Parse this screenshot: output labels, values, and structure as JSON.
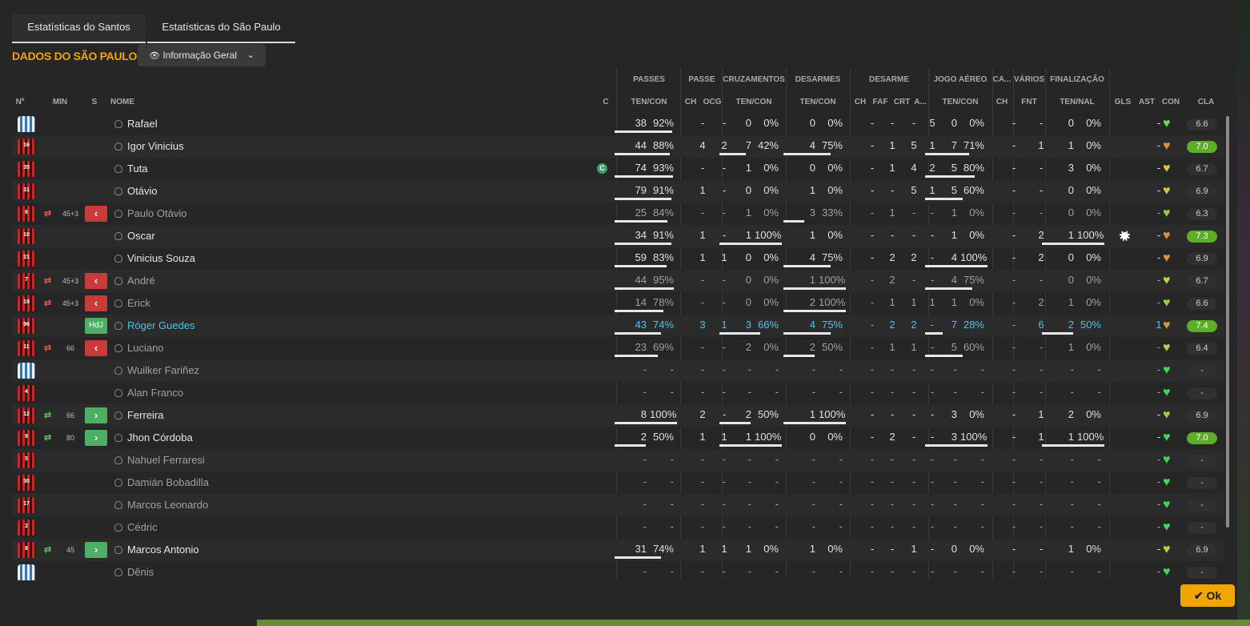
{
  "tabs": [
    "Estatísticas do Santos",
    "Estatísticas do São Paulo"
  ],
  "section_title": "DADOS DO SÃO PAULO",
  "dropdown": {
    "label": "Informação Geral",
    "icon": "eye-icon"
  },
  "group_headers": [
    "PASSES",
    "PASSE",
    "CRUZAMENTOS",
    "DESARMES",
    "DESARME",
    "JOGO AÉREO",
    "CA...",
    "VÁRIOS",
    "FINALIZAÇÃO"
  ],
  "column_headers": [
    "Nº",
    "MIN",
    "S",
    "NOME",
    "C",
    "TEN/CON",
    "CH",
    "OCG",
    "TEN/CON",
    "TEN/CON",
    "CH",
    "FAF",
    "CRT",
    "A...",
    "TEN/CON",
    "CH",
    "FNT",
    "TEN/NAL",
    "GLS",
    "AST",
    "CON",
    "CLA"
  ],
  "captain_badge": "C",
  "ok_button": "Ok",
  "players": [
    {
      "num": "",
      "kit": "gk",
      "min": "",
      "sub": "",
      "name": "Rafael",
      "style": "",
      "cap": false,
      "p": [
        "38",
        "92%"
      ],
      "pf": 0.92,
      "ch": "-",
      "ocg": "-",
      "cr": [
        "0",
        "0%"
      ],
      "crf": 0,
      "ds": [
        "0",
        "0%"
      ],
      "dsf": 0,
      "dch": "-",
      "faf": "-",
      "crt": "-",
      "a": "5",
      "ja": [
        "0",
        "0%"
      ],
      "jaf": 0,
      "ca": "-",
      "fnt": "-",
      "fn": [
        "0",
        "0%"
      ],
      "fnf": 0,
      "gls": "",
      "ast": "-",
      "heart": "#66dd55",
      "cla": "6.6",
      "good": false
    },
    {
      "num": "16",
      "kit": "sp",
      "min": "",
      "sub": "",
      "name": "Igor Vinicius",
      "style": "",
      "cap": false,
      "p": [
        "44",
        "88%"
      ],
      "pf": 0.88,
      "ch": "4",
      "ocg": "2",
      "cr": [
        "7",
        "42%"
      ],
      "crf": 0.42,
      "ds": [
        "4",
        "75%"
      ],
      "dsf": 0.75,
      "dch": "-",
      "faf": "1",
      "crt": "5",
      "a": "1",
      "ja": [
        "7",
        "71%"
      ],
      "jaf": 0.71,
      "ca": "-",
      "fnt": "1",
      "fn": [
        "1",
        "0%"
      ],
      "fnf": 0,
      "gls": "",
      "ast": "-",
      "heart": "#d9953a",
      "cla": "7.0",
      "good": true
    },
    {
      "num": "35",
      "kit": "sp",
      "min": "",
      "sub": "",
      "name": "Tuta",
      "style": "",
      "cap": true,
      "p": [
        "74",
        "93%"
      ],
      "pf": 0.93,
      "ch": "-",
      "ocg": "-",
      "cr": [
        "1",
        "0%"
      ],
      "crf": 0,
      "ds": [
        "0",
        "0%"
      ],
      "dsf": 0,
      "dch": "-",
      "faf": "1",
      "crt": "4",
      "a": "2",
      "ja": [
        "5",
        "80%"
      ],
      "jaf": 0.8,
      "ca": "-",
      "fnt": "-",
      "fn": [
        "3",
        "0%"
      ],
      "fnf": 0,
      "gls": "",
      "ast": "-",
      "heart": "#d9c43a",
      "cla": "6.7",
      "good": false
    },
    {
      "num": "31",
      "kit": "sp",
      "min": "",
      "sub": "",
      "name": "Otávio",
      "style": "",
      "cap": false,
      "p": [
        "79",
        "91%"
      ],
      "pf": 0.91,
      "ch": "1",
      "ocg": "-",
      "cr": [
        "0",
        "0%"
      ],
      "crf": 0,
      "ds": [
        "1",
        "0%"
      ],
      "dsf": 0,
      "dch": "-",
      "faf": "-",
      "crt": "5",
      "a": "1",
      "ja": [
        "5",
        "60%"
      ],
      "jaf": 0.6,
      "ca": "-",
      "fnt": "-",
      "fn": [
        "0",
        "0%"
      ],
      "fnf": 0,
      "gls": "",
      "ast": "-",
      "heart": "#d9c43a",
      "cla": "6.9",
      "good": false
    },
    {
      "num": "6",
      "kit": "sp",
      "min": "45+3",
      "sub": "out",
      "name": "Paulo Otávio",
      "style": "dim",
      "cap": false,
      "p": [
        "25",
        "84%"
      ],
      "pf": 0.84,
      "ch": "-",
      "ocg": "-",
      "cr": [
        "1",
        "0%"
      ],
      "crf": 0,
      "ds": [
        "3",
        "33%"
      ],
      "dsf": 0.33,
      "dch": "-",
      "faf": "1",
      "crt": "-",
      "a": "-",
      "ja": [
        "1",
        "0%"
      ],
      "jaf": 0,
      "ca": "-",
      "fnt": "-",
      "fn": [
        "0",
        "0%"
      ],
      "fnf": 0,
      "gls": "",
      "ast": "-",
      "heart": "#8fd23a",
      "cla": "6.3",
      "good": false
    },
    {
      "num": "10",
      "kit": "sp",
      "min": "",
      "sub": "",
      "name": "Oscar",
      "style": "",
      "cap": false,
      "p": [
        "34",
        "91%"
      ],
      "pf": 0.91,
      "ch": "1",
      "ocg": "-",
      "cr": [
        "1",
        "100%"
      ],
      "crf": 1,
      "ds": [
        "1",
        "0%"
      ],
      "dsf": 0,
      "dch": "-",
      "faf": "-",
      "crt": "-",
      "a": "-",
      "ja": [
        "1",
        "0%"
      ],
      "jaf": 0,
      "ca": "-",
      "fnt": "2",
      "fn": [
        "1",
        "100%"
      ],
      "fnf": 1,
      "gls": "ball",
      "ast": "-",
      "heart": "#d9953a",
      "cla": "7.3",
      "good": true
    },
    {
      "num": "21",
      "kit": "sp",
      "min": "",
      "sub": "",
      "name": "Vinicius Souza",
      "style": "",
      "cap": false,
      "p": [
        "59",
        "83%"
      ],
      "pf": 0.83,
      "ch": "1",
      "ocg": "1",
      "cr": [
        "0",
        "0%"
      ],
      "crf": 0,
      "ds": [
        "4",
        "75%"
      ],
      "dsf": 0.75,
      "dch": "-",
      "faf": "2",
      "crt": "2",
      "a": "-",
      "ja": [
        "4",
        "100%"
      ],
      "jaf": 1,
      "ca": "-",
      "fnt": "2",
      "fn": [
        "0",
        "0%"
      ],
      "fnf": 0,
      "gls": "",
      "ast": "-",
      "heart": "#d9953a",
      "cla": "6.9",
      "good": false
    },
    {
      "num": "7",
      "kit": "sp",
      "min": "45+3",
      "sub": "out",
      "name": "André",
      "style": "dim",
      "cap": false,
      "p": [
        "44",
        "95%"
      ],
      "pf": 0.95,
      "ch": "-",
      "ocg": "-",
      "cr": [
        "0",
        "0%"
      ],
      "crf": 0,
      "ds": [
        "1",
        "100%"
      ],
      "dsf": 1,
      "dch": "-",
      "faf": "2",
      "crt": "-",
      "a": "-",
      "ja": [
        "4",
        "75%"
      ],
      "jaf": 0.75,
      "ca": "-",
      "fnt": "-",
      "fn": [
        "0",
        "0%"
      ],
      "fnf": 0,
      "gls": "",
      "ast": "-",
      "heart": "#b8d23a",
      "cla": "6.7",
      "good": false
    },
    {
      "num": "19",
      "kit": "sp",
      "min": "45+3",
      "sub": "out",
      "name": "Erick",
      "style": "dim",
      "cap": false,
      "p": [
        "14",
        "78%"
      ],
      "pf": 0.78,
      "ch": "-",
      "ocg": "-",
      "cr": [
        "0",
        "0%"
      ],
      "crf": 0,
      "ds": [
        "2",
        "100%"
      ],
      "dsf": 1,
      "dch": "-",
      "faf": "1",
      "crt": "1",
      "a": "1",
      "ja": [
        "1",
        "0%"
      ],
      "jaf": 0,
      "ca": "-",
      "fnt": "2",
      "fn": [
        "1",
        "0%"
      ],
      "fnf": 0,
      "gls": "",
      "ast": "-",
      "heart": "#8fd23a",
      "cla": "6.6",
      "good": false
    },
    {
      "num": "96",
      "kit": "sp",
      "min": "",
      "sub": "hdj",
      "name": "Róger Guedes",
      "style": "blue",
      "cap": false,
      "p": [
        "43",
        "74%"
      ],
      "pf": 0.74,
      "ch": "3",
      "ocg": "1",
      "cr": [
        "3",
        "66%"
      ],
      "crf": 0.66,
      "ds": [
        "4",
        "75%"
      ],
      "dsf": 0.75,
      "dch": "-",
      "faf": "2",
      "crt": "2",
      "a": "-",
      "ja": [
        "7",
        "28%"
      ],
      "jaf": 0.28,
      "ca": "-",
      "fnt": "6",
      "fn": [
        "2",
        "50%"
      ],
      "fnf": 0.5,
      "gls": "",
      "ast": "1",
      "heart": "#d9953a",
      "cla": "7.4",
      "good": true
    },
    {
      "num": "11",
      "kit": "sp",
      "min": "66",
      "sub": "out",
      "name": "Luciano",
      "style": "dim",
      "cap": false,
      "p": [
        "23",
        "69%"
      ],
      "pf": 0.69,
      "ch": "-",
      "ocg": "-",
      "cr": [
        "2",
        "0%"
      ],
      "crf": 0,
      "ds": [
        "2",
        "50%"
      ],
      "dsf": 0.5,
      "dch": "-",
      "faf": "1",
      "crt": "1",
      "a": "-",
      "ja": [
        "5",
        "60%"
      ],
      "jaf": 0.6,
      "ca": "-",
      "fnt": "-",
      "fn": [
        "1",
        "0%"
      ],
      "fnf": 0,
      "gls": "",
      "ast": "-",
      "heart": "#b8d23a",
      "cla": "6.4",
      "good": false
    },
    {
      "num": "",
      "kit": "gk",
      "min": "",
      "sub": "",
      "name": "Wuilker Fariñez",
      "style": "dim",
      "cap": false,
      "p": [
        "-",
        "-"
      ],
      "pf": 0,
      "ch": "-",
      "ocg": "-",
      "cr": [
        "-",
        "-"
      ],
      "crf": 0,
      "ds": [
        "-",
        "-"
      ],
      "dsf": 0,
      "dch": "-",
      "faf": "-",
      "crt": "-",
      "a": "-",
      "ja": [
        "-",
        "-"
      ],
      "jaf": 0,
      "ca": "-",
      "fnt": "-",
      "fn": [
        "-",
        "-"
      ],
      "fnf": 0,
      "gls": "",
      "ast": "-",
      "heart": "#3ad95a",
      "cla": "-",
      "good": false
    },
    {
      "num": "4",
      "kit": "sp",
      "min": "",
      "sub": "",
      "name": "Alan Franco",
      "style": "dim",
      "cap": false,
      "p": [
        "-",
        "-"
      ],
      "pf": 0,
      "ch": "-",
      "ocg": "-",
      "cr": [
        "-",
        "-"
      ],
      "crf": 0,
      "ds": [
        "-",
        "-"
      ],
      "dsf": 0,
      "dch": "-",
      "faf": "-",
      "crt": "-",
      "a": "-",
      "ja": [
        "-",
        "-"
      ],
      "jaf": 0,
      "ca": "-",
      "fnt": "-",
      "fn": [
        "-",
        "-"
      ],
      "fnf": 0,
      "gls": "",
      "ast": "-",
      "heart": "#3ad95a",
      "cla": "-",
      "good": false
    },
    {
      "num": "12",
      "kit": "sp",
      "min": "66",
      "sub": "in",
      "name": "Ferreira",
      "style": "",
      "cap": false,
      "p": [
        "8",
        "100%"
      ],
      "pf": 1,
      "ch": "2",
      "ocg": "-",
      "cr": [
        "2",
        "50%"
      ],
      "crf": 0.5,
      "ds": [
        "1",
        "100%"
      ],
      "dsf": 1,
      "dch": "-",
      "faf": "-",
      "crt": "-",
      "a": "-",
      "ja": [
        "3",
        "0%"
      ],
      "jaf": 0,
      "ca": "-",
      "fnt": "1",
      "fn": [
        "2",
        "0%"
      ],
      "fnf": 0,
      "gls": "",
      "ast": "-",
      "heart": "#8fd23a",
      "cla": "6.9",
      "good": false
    },
    {
      "num": "9",
      "kit": "sp",
      "min": "80",
      "sub": "in",
      "name": "Jhon Córdoba",
      "style": "",
      "cap": false,
      "p": [
        "2",
        "50%"
      ],
      "pf": 0.5,
      "ch": "1",
      "ocg": "1",
      "cr": [
        "1",
        "100%"
      ],
      "crf": 1,
      "ds": [
        "0",
        "0%"
      ],
      "dsf": 0,
      "dch": "-",
      "faf": "2",
      "crt": "-",
      "a": "-",
      "ja": [
        "3",
        "100%"
      ],
      "jaf": 1,
      "ca": "-",
      "fnt": "1",
      "fn": [
        "1",
        "100%"
      ],
      "fnf": 1,
      "gls": "",
      "ast": "-",
      "heart": "#3ad95a",
      "cla": "7.0",
      "good": true
    },
    {
      "num": "5",
      "kit": "sp",
      "min": "",
      "sub": "",
      "name": "Nahuel Ferraresi",
      "style": "dim",
      "cap": false,
      "p": [
        "-",
        "-"
      ],
      "pf": 0,
      "ch": "-",
      "ocg": "-",
      "cr": [
        "-",
        "-"
      ],
      "crf": 0,
      "ds": [
        "-",
        "-"
      ],
      "dsf": 0,
      "dch": "-",
      "faf": "-",
      "crt": "-",
      "a": "-",
      "ja": [
        "-",
        "-"
      ],
      "jaf": 0,
      "ca": "-",
      "fnt": "-",
      "fn": [
        "-",
        "-"
      ],
      "fnf": 0,
      "gls": "",
      "ast": "-",
      "heart": "#3ad95a",
      "cla": "-",
      "good": false
    },
    {
      "num": "30",
      "kit": "sp",
      "min": "",
      "sub": "",
      "name": "Damián Bobadilla",
      "style": "dim",
      "cap": false,
      "p": [
        "-",
        "-"
      ],
      "pf": 0,
      "ch": "-",
      "ocg": "-",
      "cr": [
        "-",
        "-"
      ],
      "crf": 0,
      "ds": [
        "-",
        "-"
      ],
      "dsf": 0,
      "dch": "-",
      "faf": "-",
      "crt": "-",
      "a": "-",
      "ja": [
        "-",
        "-"
      ],
      "jaf": 0,
      "ca": "-",
      "fnt": "-",
      "fn": [
        "-",
        "-"
      ],
      "fnf": 0,
      "gls": "",
      "ast": "-",
      "heart": "#3ad95a",
      "cla": "-",
      "good": false
    },
    {
      "num": "17",
      "kit": "sp",
      "min": "",
      "sub": "",
      "name": "Marcos Leonardo",
      "style": "dim",
      "cap": false,
      "p": [
        "-",
        "-"
      ],
      "pf": 0,
      "ch": "-",
      "ocg": "-",
      "cr": [
        "-",
        "-"
      ],
      "crf": 0,
      "ds": [
        "-",
        "-"
      ],
      "dsf": 0,
      "dch": "-",
      "faf": "-",
      "crt": "-",
      "a": "-",
      "ja": [
        "-",
        "-"
      ],
      "jaf": 0,
      "ca": "-",
      "fnt": "-",
      "fn": [
        "-",
        "-"
      ],
      "fnf": 0,
      "gls": "",
      "ast": "-",
      "heart": "#3ad95a",
      "cla": "-",
      "good": false
    },
    {
      "num": "2",
      "kit": "sp",
      "min": "",
      "sub": "",
      "name": "Cédric",
      "style": "dim",
      "cap": false,
      "p": [
        "-",
        "-"
      ],
      "pf": 0,
      "ch": "-",
      "ocg": "-",
      "cr": [
        "-",
        "-"
      ],
      "crf": 0,
      "ds": [
        "-",
        "-"
      ],
      "dsf": 0,
      "dch": "-",
      "faf": "-",
      "crt": "-",
      "a": "-",
      "ja": [
        "-",
        "-"
      ],
      "jaf": 0,
      "ca": "-",
      "fnt": "-",
      "fn": [
        "-",
        "-"
      ],
      "fnf": 0,
      "gls": "",
      "ast": "-",
      "heart": "#3ad95a",
      "cla": "-",
      "good": false
    },
    {
      "num": "8",
      "kit": "sp",
      "min": "45",
      "sub": "in",
      "name": "Marcos Antonio",
      "style": "",
      "cap": false,
      "p": [
        "31",
        "74%"
      ],
      "pf": 0.74,
      "ch": "1",
      "ocg": "1",
      "cr": [
        "1",
        "0%"
      ],
      "crf": 0,
      "ds": [
        "1",
        "0%"
      ],
      "dsf": 0,
      "dch": "-",
      "faf": "-",
      "crt": "1",
      "a": "-",
      "ja": [
        "0",
        "0%"
      ],
      "jaf": 0,
      "ca": "-",
      "fnt": "-",
      "fn": [
        "1",
        "0%"
      ],
      "fnf": 0,
      "gls": "",
      "ast": "-",
      "heart": "#b8d23a",
      "cla": "6.9",
      "good": false
    },
    {
      "num": "",
      "kit": "gk",
      "min": "",
      "sub": "",
      "name": "Dênis",
      "style": "dim",
      "cap": false,
      "p": [
        "-",
        "-"
      ],
      "pf": 0,
      "ch": "-",
      "ocg": "-",
      "cr": [
        "-",
        "-"
      ],
      "crf": 0,
      "ds": [
        "-",
        "-"
      ],
      "dsf": 0,
      "dch": "-",
      "faf": "-",
      "crt": "-",
      "a": "-",
      "ja": [
        "-",
        "-"
      ],
      "jaf": 0,
      "ca": "-",
      "fnt": "-",
      "fn": [
        "-",
        "-"
      ],
      "fnf": 0,
      "gls": "",
      "ast": "-",
      "heart": "#3ad95a",
      "cla": "-",
      "good": false
    }
  ]
}
